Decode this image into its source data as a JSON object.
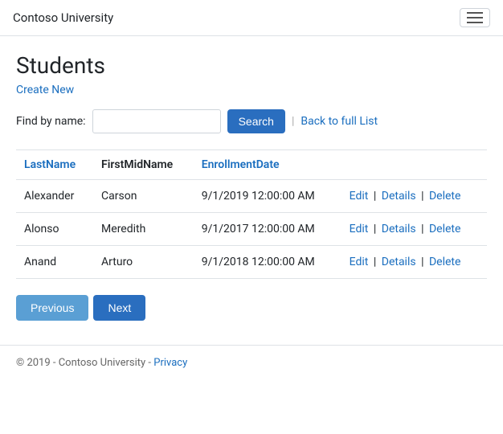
{
  "navbar": {
    "brand": "Contoso University",
    "toggler_label": "Toggle navigation"
  },
  "page": {
    "title": "Students",
    "create_new_label": "Create New"
  },
  "search": {
    "label": "Find by name:",
    "placeholder": "",
    "button_label": "Search",
    "back_label": "Back to full List"
  },
  "table": {
    "columns": [
      {
        "key": "lastName",
        "label": "LastName",
        "style": "blue"
      },
      {
        "key": "firstMidName",
        "label": "FirstMidName",
        "style": "black"
      },
      {
        "key": "enrollmentDate",
        "label": "EnrollmentDate",
        "style": "blue"
      }
    ],
    "rows": [
      {
        "lastName": "Alexander",
        "firstMidName": "Carson",
        "enrollmentDate": "9/1/2019 12:00:00 AM"
      },
      {
        "lastName": "Alonso",
        "firstMidName": "Meredith",
        "enrollmentDate": "9/1/2017 12:00:00 AM"
      },
      {
        "lastName": "Anand",
        "firstMidName": "Arturo",
        "enrollmentDate": "9/1/2018 12:00:00 AM"
      }
    ],
    "actions": [
      "Edit",
      "Details",
      "Delete"
    ]
  },
  "pagination": {
    "previous_label": "Previous",
    "next_label": "Next"
  },
  "footer": {
    "text": "© 2019 - Contoso University - ",
    "privacy_label": "Privacy"
  }
}
